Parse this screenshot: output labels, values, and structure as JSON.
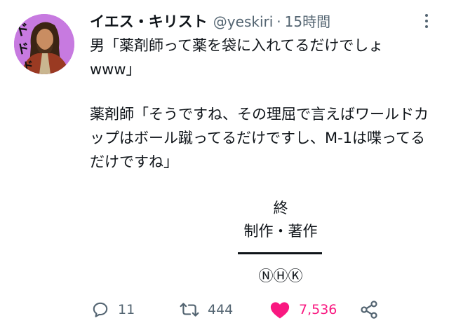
{
  "user": {
    "display_name": "イエス・キリスト",
    "handle": "@yeskiri",
    "separator": "·",
    "timestamp": "15時間",
    "avatar_overlay_text": "ドドド"
  },
  "tweet": {
    "line1": "男「薬剤師って薬を袋に入れてるだけでしょ",
    "line2": "www」",
    "paragraph2": "薬剤師「そうですね、その理屈で言えばワールドカップはボール蹴ってるだけですし、M-1は喋ってるだけですね」",
    "end_mark": "終",
    "production": "制作・著作",
    "network": "ⓃⒽⓀ"
  },
  "actions": {
    "reply_count": "11",
    "retweet_count": "444",
    "like_count": "7,536"
  },
  "colors": {
    "text": "#0f1419",
    "secondary": "#536471",
    "like": "#f91880",
    "avatar_bg": "#c77ae0"
  },
  "icons": {
    "more": "more-vertical-icon",
    "reply": "reply-icon",
    "retweet": "retweet-icon",
    "like": "heart-filled-icon",
    "share": "share-icon"
  }
}
